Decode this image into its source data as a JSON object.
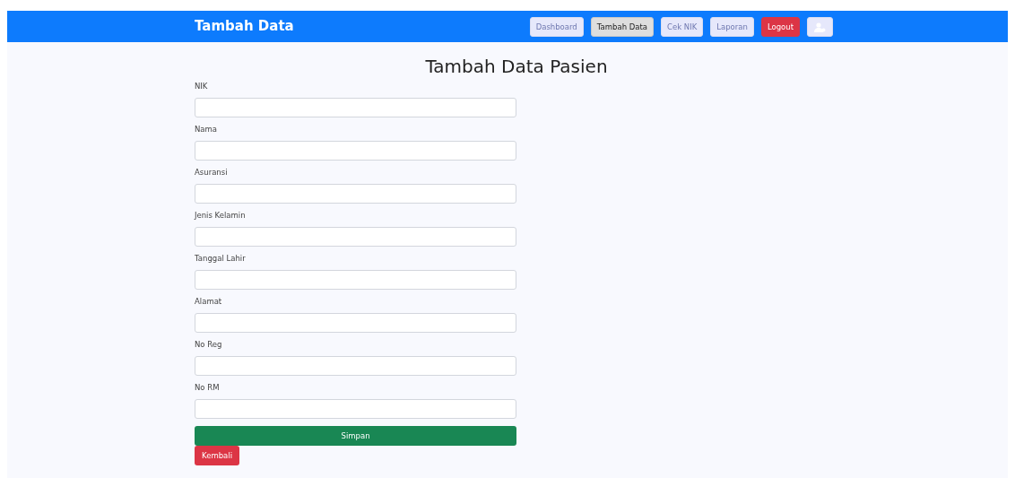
{
  "navbar": {
    "brand": "Tambah Data",
    "items": [
      {
        "label": "Dashboard",
        "kind": "link",
        "selected": false
      },
      {
        "label": "Tambah Data",
        "kind": "link",
        "selected": true
      },
      {
        "label": "Cek NIK",
        "kind": "link",
        "selected": false
      },
      {
        "label": "Laporan",
        "kind": "link",
        "selected": false
      },
      {
        "label": "Logout",
        "kind": "logout",
        "selected": false
      },
      {
        "kind": "user",
        "selected": false
      }
    ]
  },
  "title": "Tambah Data Pasien",
  "fields": [
    {
      "label": "NIK"
    },
    {
      "label": "Nama"
    },
    {
      "label": "Asuransi"
    },
    {
      "label": "Jenis Kelamin"
    },
    {
      "label": "Tanggal Lahir"
    },
    {
      "label": "Alamat"
    },
    {
      "label": "No Reg"
    },
    {
      "label": "No RM"
    }
  ],
  "buttons": [
    {
      "label": "Simpan",
      "kind": "save"
    },
    {
      "label": "Kembali",
      "kind": "back"
    }
  ]
}
